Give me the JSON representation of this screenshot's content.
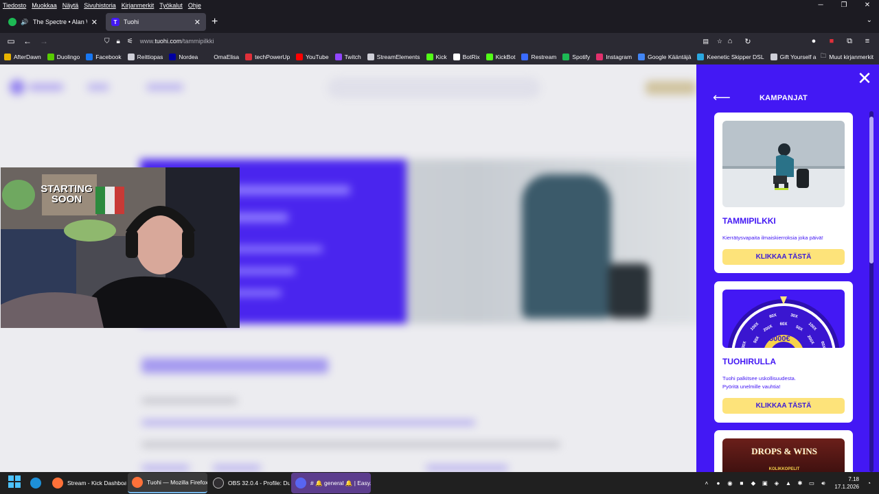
{
  "menubar": [
    "Tiedosto",
    "Muokkaa",
    "Näytä",
    "Sivuhistoria",
    "Kirjanmerkit",
    "Työkalut",
    "Ohje"
  ],
  "window_controls": {
    "minimize": "─",
    "restore": "❐",
    "close": "✕"
  },
  "tabs": [
    {
      "label": "The Spectre • Alan Walker",
      "icon": "spotify-icon",
      "color": "#1db954"
    },
    {
      "label": "Tuohi",
      "icon": "tuohi-icon",
      "color": "#4318f4",
      "glyph": "T"
    }
  ],
  "url": {
    "prefix": "www.",
    "domain": "tuohi.com",
    "path": "/tammipilkki"
  },
  "bookmarks": [
    {
      "label": "AfterDawn",
      "color": "#e8b400"
    },
    {
      "label": "Duolingo",
      "color": "#58cc02"
    },
    {
      "label": "Facebook",
      "color": "#1877f2"
    },
    {
      "label": "Reittiopas",
      "color": "#cfcfd8"
    },
    {
      "label": "Nordea",
      "color": "#0000a0"
    },
    {
      "label": "OmaElisa",
      "color": "#2b2a33"
    },
    {
      "label": "techPowerUp",
      "color": "#e0303a"
    },
    {
      "label": "YouTube",
      "color": "#ff0000"
    },
    {
      "label": "Twitch",
      "color": "#9146ff"
    },
    {
      "label": "StreamElements",
      "color": "#cfcfd8"
    },
    {
      "label": "Kick",
      "color": "#53fc18"
    },
    {
      "label": "BotRix",
      "color": "#ffffff"
    },
    {
      "label": "KickBot",
      "color": "#53fc18"
    },
    {
      "label": "Restream",
      "color": "#3a6bff"
    },
    {
      "label": "Spotify",
      "color": "#1db954"
    },
    {
      "label": "Instagram",
      "color": "#e1306c"
    },
    {
      "label": "Google Kääntäjä",
      "color": "#4285f4"
    },
    {
      "label": "Keenetic Skipper DSL",
      "color": "#2aa8e0"
    },
    {
      "label": "Gift Yourself a Holiday...",
      "color": "#cfcfd8"
    }
  ],
  "other_bookmarks": "Muut kirjanmerkit",
  "panel": {
    "title": "KAMPANJAT",
    "cards": [
      {
        "title": "TAMMIPILKKI",
        "desc": [
          "Kierrätysvapaita ilmaiskierroksia joka päivä!"
        ],
        "button": "KLIKKAA TÄSTÄ"
      },
      {
        "title": "TUOHIRULLA",
        "desc": [
          "Tuohi palkitsee uskollisuudesta.",
          "Pyöritä unelmille vauhtia!"
        ],
        "button": "KLIKKAA TÄSTÄ",
        "wheel": {
          "segments": [
            "30X",
            "50X",
            "100X",
            "200X",
            "60X",
            "60X",
            "30X",
            "50X",
            "100X",
            "200X",
            "60X"
          ],
          "prize": "5000€"
        }
      },
      {
        "title": "DROPS & WINS",
        "subtitle": "KOLIKKOPELIT"
      }
    ]
  },
  "webcam": {
    "poster": [
      "STARTING",
      "SOON"
    ]
  },
  "taskbar": {
    "apps": [
      {
        "label": "Stream - Kick Dashboar",
        "color": "#ff7139"
      },
      {
        "label": "Tuohi — Mozilla Firefox",
        "color": "#ff7139"
      },
      {
        "label": "OBS 32.0.4 - Profile: Dua",
        "color": "#302e31"
      },
      {
        "label": "# 🔔 general 🔔 | Easy. G",
        "color": "#5865f2"
      }
    ],
    "time": "7.18",
    "date": "17.1.2026"
  }
}
